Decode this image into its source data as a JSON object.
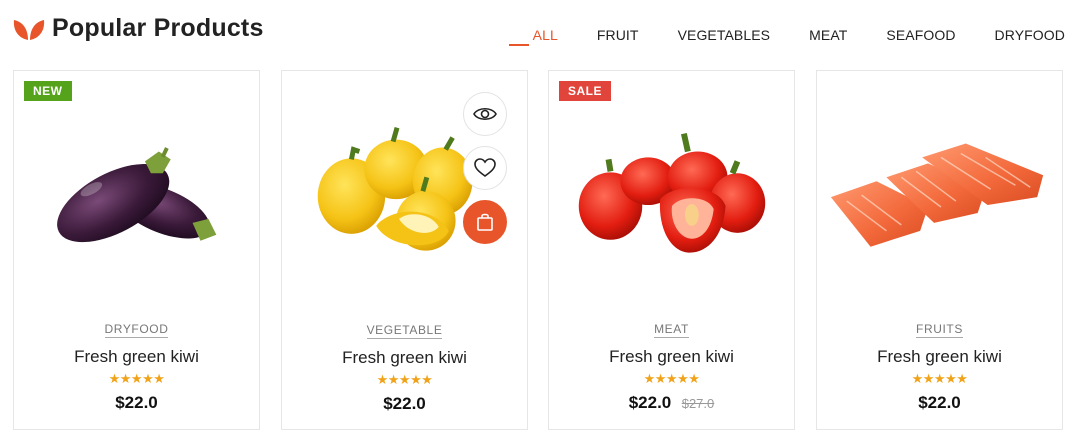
{
  "header": {
    "title": "Popular Products",
    "logo_icon": "leaf-icon"
  },
  "tabs": [
    {
      "label": "ALL",
      "active": true
    },
    {
      "label": "FRUIT",
      "active": false
    },
    {
      "label": "VEGETABLES",
      "active": false
    },
    {
      "label": "MEAT",
      "active": false
    },
    {
      "label": "SEAFOOD",
      "active": false
    },
    {
      "label": "DRYFOOD",
      "active": false
    }
  ],
  "products": [
    {
      "badge": "NEW",
      "image": "eggplant",
      "category": "DRYFOOD",
      "name": "Fresh green kiwi",
      "rating": "★★★★★",
      "price": "$22.0",
      "old_price": ""
    },
    {
      "badge": "",
      "image": "yellow-bell-peppers",
      "category": "VEGETABLE",
      "name": "Fresh green kiwi",
      "rating": "★★★★★",
      "price": "$22.0",
      "old_price": "",
      "actions": [
        "eye-icon",
        "heart-icon",
        "shopping-bag-icon"
      ]
    },
    {
      "badge": "SALE",
      "image": "red-bell-peppers",
      "category": "MEAT",
      "name": "Fresh green kiwi",
      "rating": "★★★★★",
      "price": "$22.0",
      "old_price": "$27.0"
    },
    {
      "badge": "",
      "image": "salmon-fillets",
      "category": "FRUITS",
      "name": "Fresh green kiwi",
      "rating": "★★★★★",
      "price": "$22.0",
      "old_price": ""
    }
  ],
  "colors": {
    "accent": "#e8552a",
    "new_badge": "#54a31b",
    "sale_badge": "#e0443a",
    "stars": "#f0a319"
  }
}
